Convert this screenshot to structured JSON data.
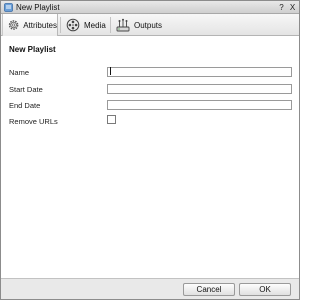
{
  "window": {
    "title": "New Playlist",
    "help_label": "?",
    "close_label": "X",
    "icon": "playlist-icon"
  },
  "tabs": [
    {
      "label": "Attributes",
      "icon": "gear-icon",
      "active": true
    },
    {
      "label": "Media",
      "icon": "film-reel-icon",
      "active": false
    },
    {
      "label": "Outputs",
      "icon": "network-outputs-icon",
      "active": false
    }
  ],
  "form": {
    "heading": "New Playlist",
    "name": {
      "label": "Name",
      "value": ""
    },
    "start_date": {
      "label": "Start Date",
      "value": ""
    },
    "end_date": {
      "label": "End Date",
      "value": ""
    },
    "remove_urls": {
      "label": "Remove URLs",
      "checked": false
    }
  },
  "footer": {
    "cancel_label": "Cancel",
    "ok_label": "OK"
  }
}
